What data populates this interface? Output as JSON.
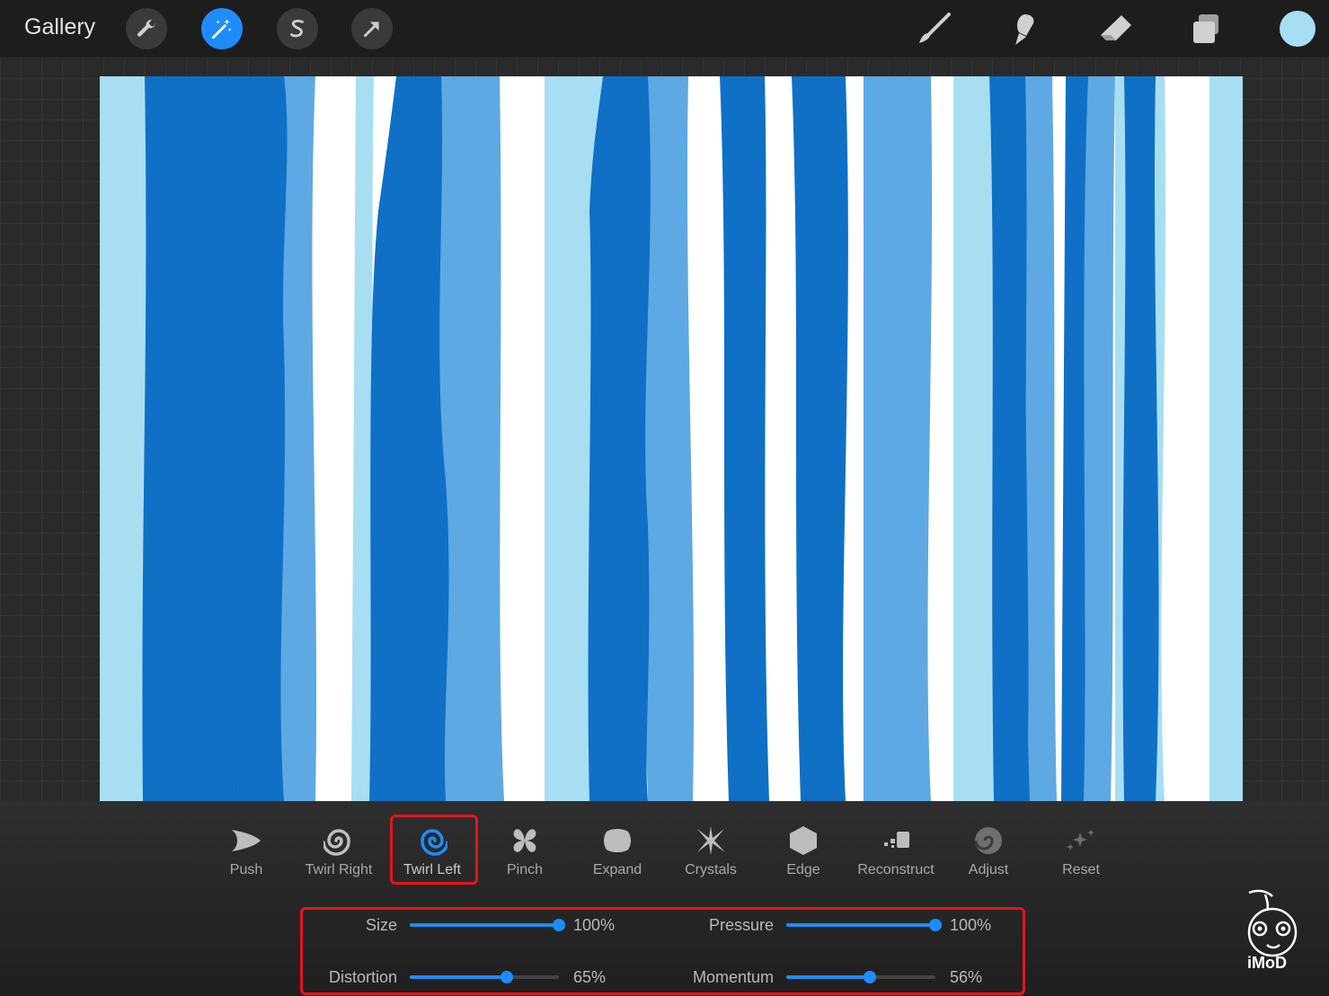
{
  "topbar": {
    "gallery_label": "Gallery",
    "left_tools": [
      {
        "icon": "wrench-icon",
        "active": false
      },
      {
        "icon": "magic-wand-icon",
        "active": true
      },
      {
        "icon": "selection-s-icon",
        "active": false
      },
      {
        "icon": "transform-arrow-icon",
        "active": false
      }
    ],
    "right_tools": [
      "brush-icon",
      "smudge-icon",
      "eraser-icon",
      "layers-icon"
    ],
    "current_color": "#a8def2"
  },
  "canvas": {
    "palette": {
      "dark_blue": "#0f70c6",
      "mid_blue": "#5ea8e4",
      "light_blue": "#a8def2",
      "white": "#ffffff"
    }
  },
  "liquify": {
    "modes": [
      {
        "label": "Push",
        "icon": "push-icon"
      },
      {
        "label": "Twirl Right",
        "icon": "twirl-right-icon"
      },
      {
        "label": "Twirl Left",
        "icon": "twirl-left-icon",
        "selected": true
      },
      {
        "label": "Pinch",
        "icon": "pinch-icon"
      },
      {
        "label": "Expand",
        "icon": "expand-icon"
      },
      {
        "label": "Crystals",
        "icon": "crystals-icon"
      },
      {
        "label": "Edge",
        "icon": "edge-icon"
      },
      {
        "label": "Reconstruct",
        "icon": "reconstruct-icon"
      },
      {
        "label": "Adjust",
        "icon": "adjust-icon"
      },
      {
        "label": "Reset",
        "icon": "reset-sparkle-icon"
      }
    ],
    "sliders": [
      {
        "label": "Size",
        "value": 100,
        "display": "100%"
      },
      {
        "label": "Pressure",
        "value": 100,
        "display": "100%"
      },
      {
        "label": "Distortion",
        "value": 65,
        "display": "65%"
      },
      {
        "label": "Momentum",
        "value": 56,
        "display": "56%"
      }
    ],
    "accent": "#1e8cff",
    "highlight_color": "#e8141c"
  },
  "watermark": {
    "text": "iMoD"
  }
}
